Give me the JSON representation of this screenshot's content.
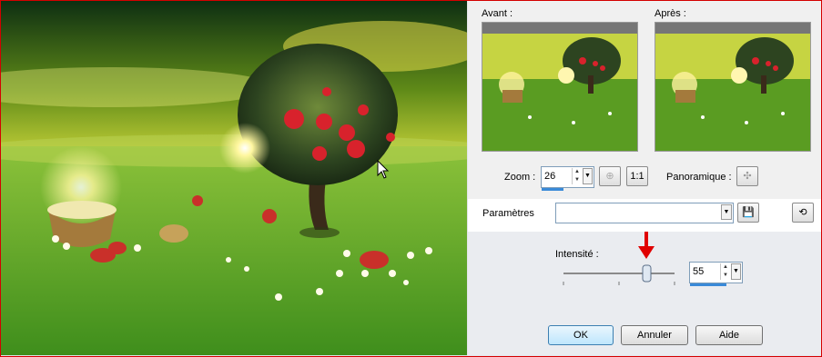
{
  "preview": {
    "before_label": "Avant :",
    "after_label": "Après :"
  },
  "zoom": {
    "label": "Zoom :",
    "value": "26"
  },
  "pan": {
    "label": "Panoramique :"
  },
  "settings": {
    "label": "Paramètres",
    "value": ""
  },
  "intensity": {
    "label": "Intensité :",
    "value": "55",
    "slider_fraction": 0.55
  },
  "buttons": {
    "ok": "OK",
    "cancel": "Annuler",
    "help": "Aide"
  },
  "colors": {
    "frame_border": "#d40000",
    "accent_blue": "#3a8ad8",
    "arrow_red": "#e00000"
  },
  "icons": [
    "cursor-icon",
    "spin-up-icon",
    "spin-down-icon",
    "dropdown-icon",
    "reset-zoom-icon",
    "actual-size-icon",
    "pan-icon",
    "save-icon",
    "load-preset-icon",
    "slider-thumb-icon",
    "red-arrow-icon"
  ]
}
